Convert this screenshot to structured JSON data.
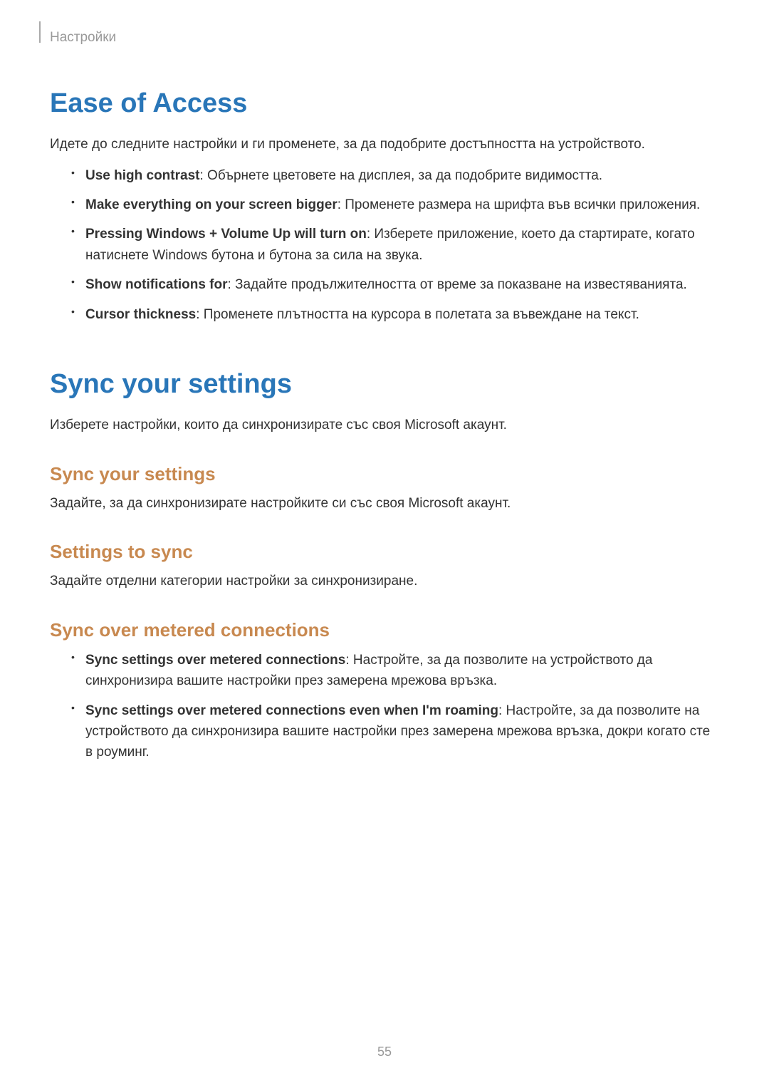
{
  "header": {
    "label": "Настройки"
  },
  "section1": {
    "title": "Ease of Access",
    "intro": "Идете до следните настройки и ги променете, за да подобрите достъпността на устройството.",
    "items": [
      {
        "bold": "Use high contrast",
        "text": ": Обърнете цветовете на дисплея, за да подобрите видимостта."
      },
      {
        "bold": "Make everything on your screen bigger",
        "text": ": Променете размера на шрифта във всички приложения."
      },
      {
        "bold": "Pressing Windows + Volume Up will turn on",
        "text": ": Изберете приложение, което да стартирате, когато натиснете Windows бутона и бутона за сила на звука."
      },
      {
        "bold": "Show notifications for",
        "text": ": Задайте продължителността от време за показване на известяванията."
      },
      {
        "bold": "Cursor thickness",
        "text": ": Променете плътността на курсора в полетата за въвеждане на текст."
      }
    ]
  },
  "section2": {
    "title": "Sync your settings",
    "intro": "Изберете настройки, които да синхронизирате със своя Microsoft акаунт.",
    "sub1": {
      "title": "Sync your settings",
      "desc": "Задайте, за да синхронизирате настройките си със своя Microsoft акаунт."
    },
    "sub2": {
      "title": "Settings to sync",
      "desc": "Задайте отделни категории настройки за синхронизиране."
    },
    "sub3": {
      "title": "Sync over metered connections",
      "items": [
        {
          "bold": "Sync settings over metered connections",
          "text": ": Настройте, за да позволите на устройството да синхронизира вашите настройки през замерена мрежова връзка."
        },
        {
          "bold": "Sync settings over metered connections even when I'm roaming",
          "text": ": Настройте, за да позволите на устройството да синхронизира вашите настройки през замерена мрежова връзка, докри когато сте в роуминг."
        }
      ]
    }
  },
  "pageNumber": "55"
}
